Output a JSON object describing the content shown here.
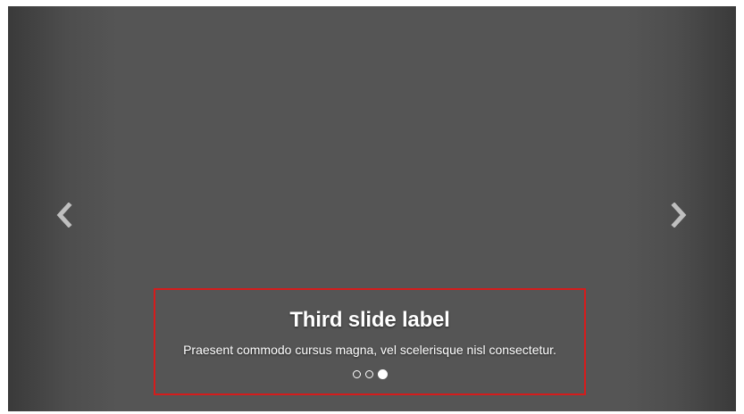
{
  "carousel": {
    "controls": {
      "prev_icon": "chevron-left-icon",
      "next_icon": "chevron-right-icon"
    },
    "caption": {
      "title": "Third slide label",
      "text": "Praesent commodo cursus magna, vel scelerisque nisl consectetur."
    },
    "indicators": {
      "count": 3,
      "active_index": 2
    },
    "colors": {
      "background": "#555555",
      "caption_border": "#d51c1c",
      "text": "#ffffff"
    }
  }
}
